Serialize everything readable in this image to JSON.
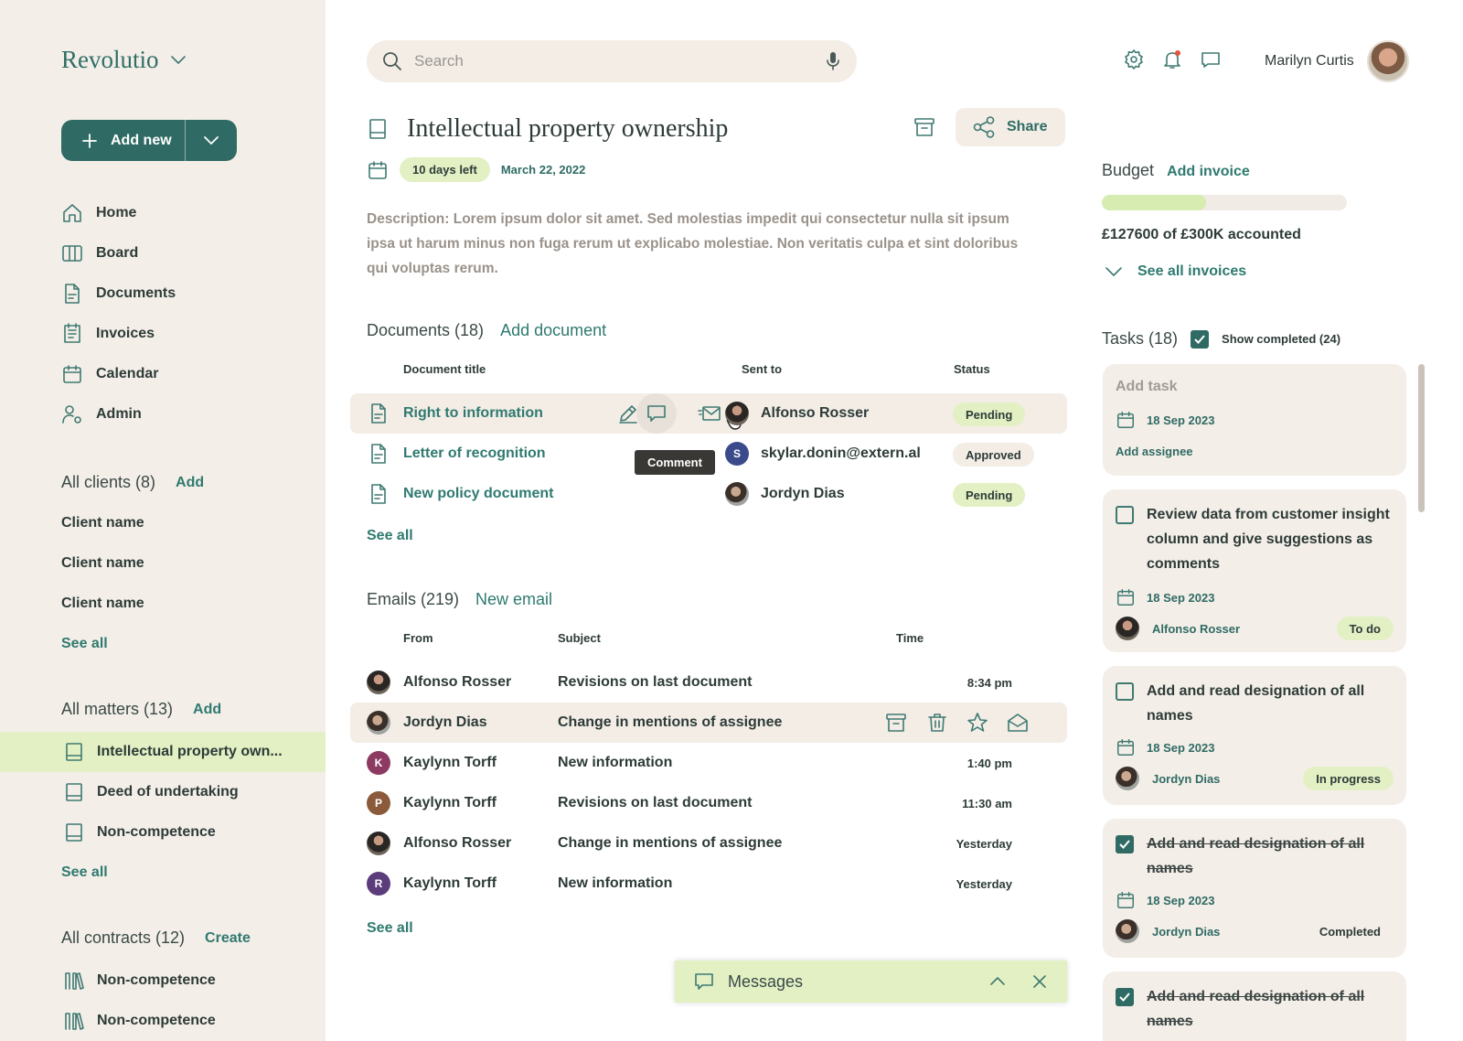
{
  "brand": {
    "name": "Revolutio"
  },
  "add_new": {
    "label": "Add new"
  },
  "nav": [
    {
      "label": "Home",
      "icon": "home-icon"
    },
    {
      "label": "Board",
      "icon": "board-icon"
    },
    {
      "label": "Documents",
      "icon": "document-icon"
    },
    {
      "label": "Invoices",
      "icon": "invoice-icon"
    },
    {
      "label": "Calendar",
      "icon": "calendar-icon"
    },
    {
      "label": "Admin",
      "icon": "admin-icon"
    }
  ],
  "clients": {
    "title": "All clients (8)",
    "add_label": "Add",
    "items": [
      "Client name",
      "Client name",
      "Client name"
    ],
    "see_all": "See all"
  },
  "matters": {
    "title": "All matters (13)",
    "add_label": "Add",
    "items": [
      "Intellectual property own...",
      "Deed of undertaking",
      "Non-competence"
    ],
    "see_all": "See all"
  },
  "contracts": {
    "title": "All contracts (12)",
    "add_label": "Create",
    "items": [
      "Non-competence",
      "Non-competence"
    ]
  },
  "search": {
    "placeholder": "Search"
  },
  "user": {
    "name": "Marilyn Curtis"
  },
  "matter": {
    "title": "Intellectual property ownership",
    "share_label": "Share",
    "days_left": "10 days left",
    "date": "March 22, 2022",
    "description": "Description: Lorem ipsum dolor sit amet. Sed molestias impedit qui consectetur nulla sit ipsum ipsa ut harum minus non fuga rerum ut explicabo molestiae. Non veritatis culpa et sint doloribus qui voluptas rerum."
  },
  "documents": {
    "title": "Documents (18)",
    "add_label": "Add document",
    "columns": {
      "title": "Document title",
      "sent_to": "Sent to",
      "status": "Status"
    },
    "rows": [
      {
        "title": "Right to information",
        "sent_to": "Alfonso Rosser",
        "status": "Pending"
      },
      {
        "title": "Letter of recognition",
        "sent_to": "skylar.donin@extern.al",
        "status": "Approved"
      },
      {
        "title": "New policy document",
        "sent_to": "Jordyn Dias",
        "status": "Pending"
      }
    ],
    "see_all": "See all",
    "tooltip": "Comment"
  },
  "emails": {
    "title": "Emails (219)",
    "add_label": "New email",
    "columns": {
      "from": "From",
      "subject": "Subject",
      "time": "Time"
    },
    "rows": [
      {
        "from": "Alfonso Rosser",
        "subject": "Revisions on last document",
        "time": "8:34 pm",
        "initial": "",
        "color": ""
      },
      {
        "from": "Jordyn Dias",
        "subject": "Change in mentions of assignee",
        "time": "",
        "initial": "",
        "color": ""
      },
      {
        "from": "Kaylynn Torff",
        "subject": "New information",
        "time": "1:40 pm",
        "initial": "K",
        "color": "#8c3a62"
      },
      {
        "from": "Kaylynn Torff",
        "subject": "Revisions on last document",
        "time": "11:30 am",
        "initial": "P",
        "color": "#8a5a3a"
      },
      {
        "from": "Alfonso Rosser",
        "subject": "Change in mentions of assignee",
        "time": "Yesterday",
        "initial": "",
        "color": ""
      },
      {
        "from": "Kaylynn Torff",
        "subject": "New information",
        "time": "Yesterday",
        "initial": "R",
        "color": "#5a3d7a"
      }
    ],
    "see_all": "See all"
  },
  "messages": {
    "label": "Messages"
  },
  "budget": {
    "title": "Budget",
    "add_label": "Add invoice",
    "accounted": 127600,
    "total": 300000,
    "text": "£127600 of £300K accounted",
    "see_all": "See all invoices"
  },
  "tasks": {
    "title": "Tasks (18)",
    "show_completed": "Show completed (24)",
    "add_task": {
      "placeholder": "Add task",
      "date": "18 Sep 2023",
      "add_assignee": "Add assignee"
    },
    "items": [
      {
        "title": "Review data from customer insight column and give suggestions as comments",
        "date": "18 Sep 2023",
        "assignee": "Alfonso Rosser",
        "status": "To do",
        "done": false
      },
      {
        "title": "Add and read designation of all names",
        "date": "18 Sep 2023",
        "assignee": "Jordyn Dias",
        "status": "In progress",
        "done": false
      },
      {
        "title": "Add and read designation of all names",
        "date": "18 Sep 2023",
        "assignee": "Jordyn Dias",
        "status": "Completed",
        "done": true
      },
      {
        "title": "Add and read designation of all names",
        "done": true
      }
    ]
  },
  "colors": {
    "accent": "#2f6b64",
    "highlight": "#e3f0c4",
    "sidebar": "#f4eee8"
  }
}
